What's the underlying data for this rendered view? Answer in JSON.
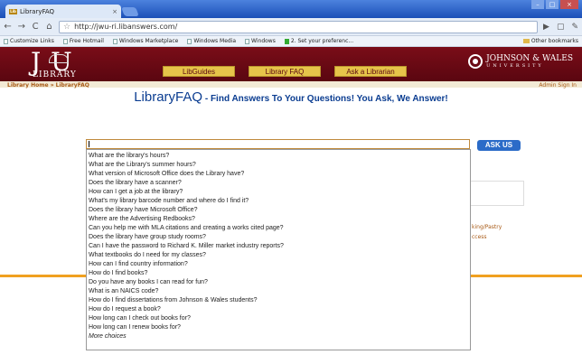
{
  "browser": {
    "tab_title": "LibraryFAQ",
    "url": "http://jwu-ri.libanswers.com/",
    "bookmarks": [
      "Customize Links",
      "Free Hotmail",
      "Windows Marketplace",
      "Windows Media",
      "Windows",
      "2. Set your preferenc..."
    ],
    "other_bookmarks": "Other bookmarks"
  },
  "header": {
    "logo_big": "J U",
    "logo_sub": "LIBRARY",
    "nav": [
      "LibGuides",
      "Library FAQ",
      "Ask a Librarian"
    ],
    "university_name": "JOHNSON & WALES",
    "university_sub": "UNIVERSITY"
  },
  "crumbs": {
    "text": "Library Home » LibraryFAQ",
    "signin": "Admin Sign In"
  },
  "headline": {
    "main": "LibraryFAQ",
    "sub": " - Find Answers To Your Questions! You Ask, We Answer!"
  },
  "search": {
    "value": "",
    "button": "ASK US"
  },
  "background": {
    "text1": "king/Pastry",
    "text2": "ccess"
  },
  "suggestions": [
    "What are the library's hours?",
    "What are the Library's summer hours?",
    "What version of Microsoft Office does the Library have?",
    "Does the library have a scanner?",
    "How can I get a job at the library?",
    "What's my library barcode number and where do I find it?",
    "Does the library have Microsoft Office?",
    "Where are the Advertising Redbooks?",
    "Can you help me with MLA citations and creating a works cited page?",
    "Does the library have group study rooms?",
    "Can I have the password to Richard K. Miller market industry reports?",
    "What textbooks do I need for my classes?",
    "How can I find country information?",
    "How do I find books?",
    "Do you have any books I can read for fun?",
    "What is an NAICS code?",
    "How do I find dissertations from Johnson & Wales students?",
    "How do I request a book?",
    "How long can I check out books for?",
    "How long can I renew books for?"
  ],
  "more_choices": "More choices"
}
